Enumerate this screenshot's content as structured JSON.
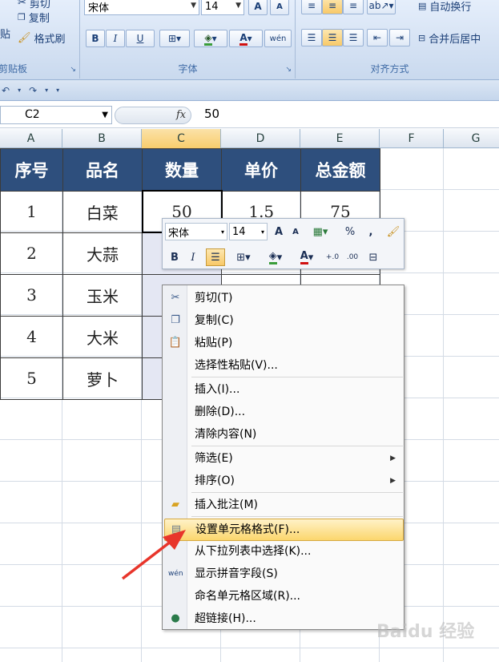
{
  "ribbon": {
    "clipboard": {
      "partial_top": "剪切",
      "copy": "复制",
      "paste_partial": "贴",
      "format_painter": "格式刷",
      "label": "剪贴板"
    },
    "font": {
      "family": "宋体",
      "size": "14",
      "grow": "A",
      "shrink": "A",
      "bold": "B",
      "italic": "I",
      "underline": "U",
      "color_a": "A",
      "label": "字体"
    },
    "align": {
      "wrap": "自动换行",
      "merge": "合并后居中",
      "label": "对齐方式"
    }
  },
  "formula_bar": {
    "name_box": "C2",
    "fx": "fx",
    "value": "50"
  },
  "columns": [
    "A",
    "B",
    "C",
    "D",
    "E",
    "F",
    "G"
  ],
  "table": {
    "headers": [
      "序号",
      "品名",
      "数量",
      "单价",
      "总金额"
    ],
    "rows": [
      [
        "1",
        "白菜",
        "50",
        "1.5",
        "75"
      ],
      [
        "2",
        "大蒜",
        "",
        "",
        ""
      ],
      [
        "3",
        "玉米",
        "",
        "",
        ""
      ],
      [
        "4",
        "大米",
        "",
        "",
        ""
      ],
      [
        "5",
        "萝卜",
        "",
        "",
        ""
      ]
    ]
  },
  "mini_toolbar": {
    "font": "宋体",
    "size": "14",
    "grow": "A",
    "shrink": "A",
    "percent": "%",
    "comma": ",",
    "bold": "B",
    "italic": "I",
    "font_color": "A"
  },
  "context_menu": {
    "items": [
      {
        "label": "剪切(T)",
        "icon": "scissors-icon"
      },
      {
        "label": "复制(C)",
        "icon": "copy-icon"
      },
      {
        "label": "粘贴(P)",
        "icon": "paste-icon"
      },
      {
        "label": "选择性粘贴(V)...",
        "icon": ""
      },
      {
        "label": "插入(I)...",
        "icon": ""
      },
      {
        "label": "删除(D)...",
        "icon": ""
      },
      {
        "label": "清除内容(N)",
        "icon": ""
      },
      {
        "label": "筛选(E)",
        "icon": "",
        "submenu": true
      },
      {
        "label": "排序(O)",
        "icon": "",
        "submenu": true
      },
      {
        "label": "插入批注(M)",
        "icon": "comment-folder-icon"
      },
      {
        "label": "设置单元格格式(F)...",
        "icon": "format-cells-icon",
        "highlight": true
      },
      {
        "label": "从下拉列表中选择(K)...",
        "icon": ""
      },
      {
        "label": "显示拼音字段(S)",
        "icon": "phonetic-icon"
      },
      {
        "label": "命名单元格区域(R)...",
        "icon": ""
      },
      {
        "label": "超链接(H)...",
        "icon": "hyperlink-icon"
      }
    ]
  },
  "watermark": "Baidu 经验",
  "colors": {
    "header_bg": "#2e4f7d",
    "highlight": "#fbd66d",
    "arrow": "#e8352b"
  }
}
